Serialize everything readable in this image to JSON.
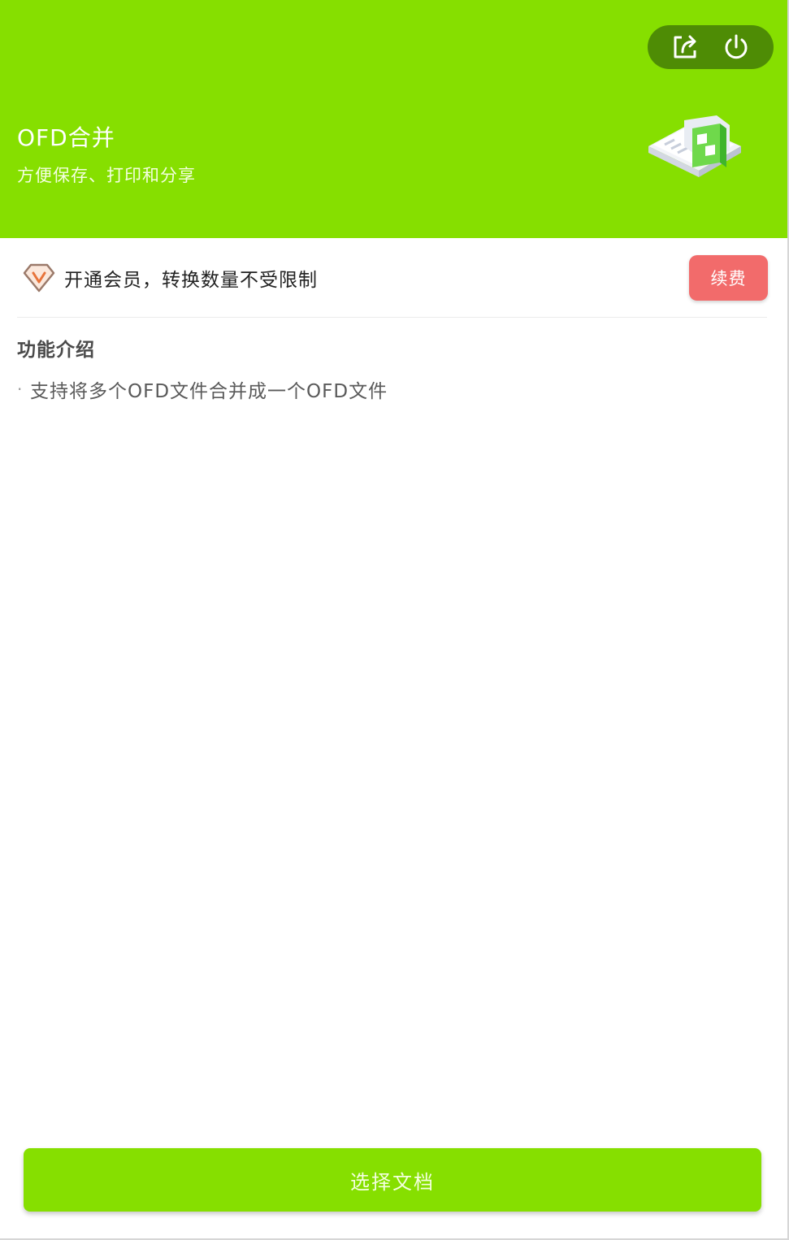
{
  "header": {
    "title": "OFD合并",
    "subtitle": "方便保存、打印和分享"
  },
  "controls": {
    "share_icon": "share-icon",
    "power_icon": "power-icon"
  },
  "member": {
    "text": "开通会员，转换数量不受限制",
    "renew_label": "续费",
    "vip_icon": "vip-diamond-icon"
  },
  "features": {
    "title": "功能介绍",
    "bullet": "·",
    "items": [
      "支持将多个OFD文件合并成一个OFD文件"
    ]
  },
  "actions": {
    "select_label": "选择文档"
  },
  "colors": {
    "brand_green": "#86df00",
    "renew_red": "#f26b6b"
  }
}
